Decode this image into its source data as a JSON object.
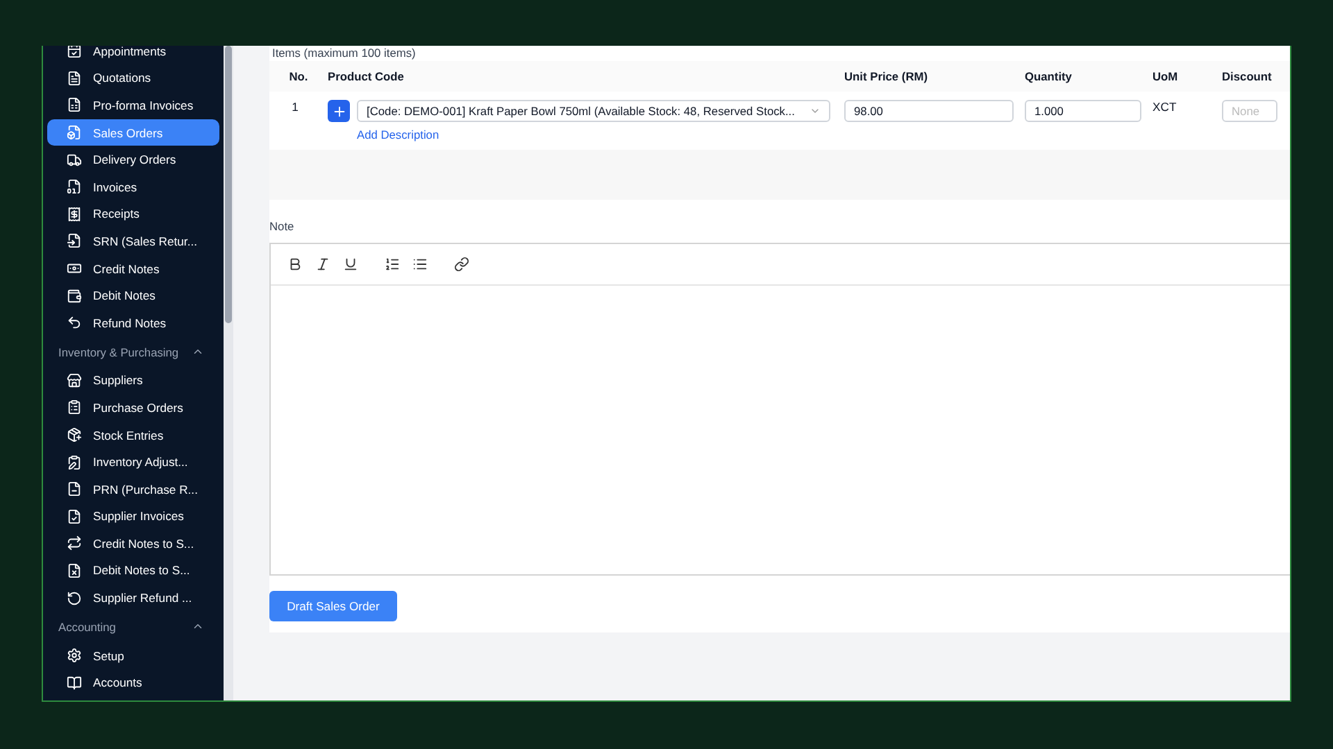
{
  "sidebar": {
    "groups": [
      {
        "items": [
          {
            "label": "Appointments",
            "selected": false
          },
          {
            "label": "Quotations",
            "selected": false
          },
          {
            "label": "Pro-forma Invoices",
            "selected": false
          },
          {
            "label": "Sales Orders",
            "selected": true
          },
          {
            "label": "Delivery Orders",
            "selected": false
          },
          {
            "label": "Invoices",
            "selected": false
          },
          {
            "label": "Receipts",
            "selected": false
          },
          {
            "label": "SRN (Sales Retur...",
            "selected": false
          },
          {
            "label": "Credit Notes",
            "selected": false
          },
          {
            "label": "Debit Notes",
            "selected": false
          },
          {
            "label": "Refund Notes",
            "selected": false
          }
        ]
      },
      {
        "title": "Inventory & Purchasing",
        "expanded": true,
        "items": [
          {
            "label": "Suppliers",
            "selected": false
          },
          {
            "label": "Purchase Orders",
            "selected": false
          },
          {
            "label": "Stock Entries",
            "selected": false
          },
          {
            "label": "Inventory Adjust...",
            "selected": false
          },
          {
            "label": "PRN (Purchase R...",
            "selected": false
          },
          {
            "label": "Supplier Invoices",
            "selected": false
          },
          {
            "label": "Credit Notes to S...",
            "selected": false
          },
          {
            "label": "Debit Notes to S...",
            "selected": false
          },
          {
            "label": "Supplier Refund ...",
            "selected": false
          }
        ]
      },
      {
        "title": "Accounting",
        "expanded": true,
        "items": [
          {
            "label": "Setup",
            "selected": false
          },
          {
            "label": "Accounts",
            "selected": false
          }
        ]
      }
    ]
  },
  "items": {
    "title": "Items (maximum 100 items)",
    "columns": [
      "No.",
      "Product Code",
      "Unit Price (RM)",
      "Quantity",
      "UoM",
      "Discount"
    ],
    "rows": [
      {
        "no": "1",
        "product": "[Code: DEMO-001] Kraft Paper Bowl 750ml (Available Stock: 48, Reserved Stock...",
        "add_description": "Add Description",
        "unit_price": "98.00",
        "quantity": "1.000",
        "uom": "XCT",
        "discount_placeholder": "None"
      }
    ]
  },
  "note": {
    "label": "Note"
  },
  "submit_button": "Draft Sales Order"
}
